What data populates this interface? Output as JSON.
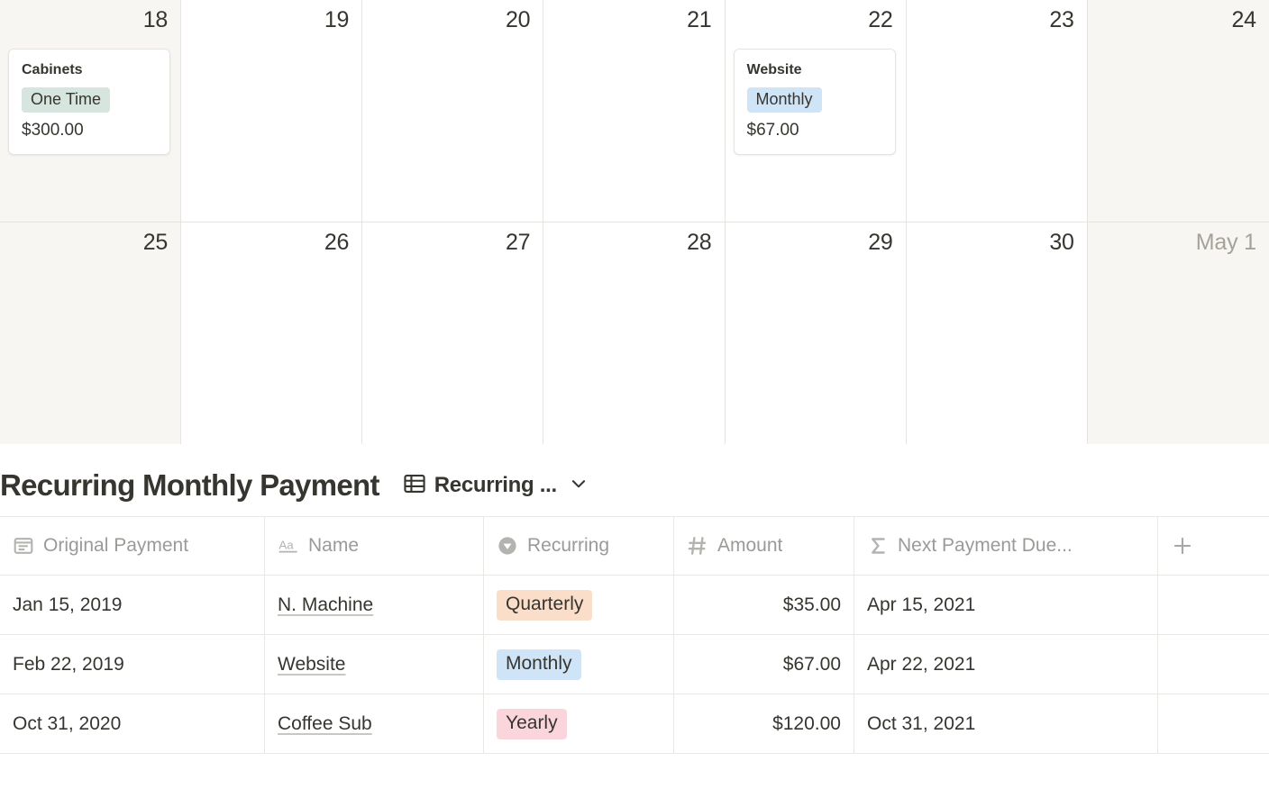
{
  "calendar": {
    "weeks": [
      {
        "days": [
          {
            "label": "18",
            "weekend": true,
            "muted": false,
            "event": {
              "title": "Cabinets",
              "badge": "One Time",
              "badge_color": "#d6e5dd",
              "amount": "$300.00"
            }
          },
          {
            "label": "19",
            "weekend": false,
            "muted": false,
            "event": null
          },
          {
            "label": "20",
            "weekend": false,
            "muted": false,
            "event": null
          },
          {
            "label": "21",
            "weekend": false,
            "muted": false,
            "event": null
          },
          {
            "label": "22",
            "weekend": false,
            "muted": false,
            "event": {
              "title": "Website",
              "badge": "Monthly",
              "badge_color": "#cfe4f7",
              "amount": "$67.00"
            }
          },
          {
            "label": "23",
            "weekend": false,
            "muted": false,
            "event": null
          },
          {
            "label": "24",
            "weekend": true,
            "muted": false,
            "event": null
          }
        ]
      },
      {
        "days": [
          {
            "label": "25",
            "weekend": true,
            "muted": false,
            "event": null
          },
          {
            "label": "26",
            "weekend": false,
            "muted": false,
            "event": null
          },
          {
            "label": "27",
            "weekend": false,
            "muted": false,
            "event": null
          },
          {
            "label": "28",
            "weekend": false,
            "muted": false,
            "event": null
          },
          {
            "label": "29",
            "weekend": false,
            "muted": false,
            "event": null
          },
          {
            "label": "30",
            "weekend": false,
            "muted": false,
            "event": null
          },
          {
            "label": "May 1",
            "weekend": true,
            "muted": true,
            "event": null
          }
        ]
      }
    ]
  },
  "database": {
    "title": "Recurring Monthly Payment",
    "view_name": "Recurring ...",
    "view_icon": "table-icon",
    "chevron_icon": "chevron-down-icon",
    "add_column_label": "+",
    "columns": [
      {
        "label": "Original Payment",
        "icon": "date-icon",
        "align": "left"
      },
      {
        "label": "Name",
        "icon": "text-icon",
        "align": "left"
      },
      {
        "label": "Recurring",
        "icon": "select-icon",
        "align": "left"
      },
      {
        "label": "Amount",
        "icon": "number-icon",
        "align": "right"
      },
      {
        "label": "Next Payment Due...",
        "icon": "formula-icon",
        "align": "left"
      }
    ],
    "rows": [
      {
        "original_payment": "Jan 15, 2019",
        "name": "N. Machine",
        "recurring": "Quarterly",
        "recurring_color": "#fadec9",
        "amount": "$35.00",
        "next_payment_due": "Apr 15, 2021"
      },
      {
        "original_payment": "Feb 22, 2019",
        "name": "Website",
        "recurring": "Monthly",
        "recurring_color": "#cfe4f7",
        "amount": "$67.00",
        "next_payment_due": "Apr 22, 2021"
      },
      {
        "original_payment": "Oct 31, 2020",
        "name": "Coffee Sub",
        "recurring": "Yearly",
        "recurring_color": "#fbd5dc",
        "amount": "$120.00",
        "next_payment_due": "Oct 31, 2021"
      }
    ]
  },
  "colors": {
    "weekend_cell": "#f7f6f3",
    "border": "#e6e4e0",
    "text": "#37352f",
    "muted_text": "#9b9a97"
  }
}
